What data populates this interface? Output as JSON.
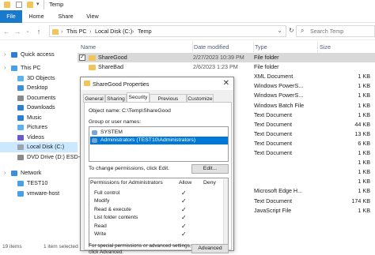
{
  "window": {
    "title": "Temp"
  },
  "ribbon": {
    "tabs": [
      "File",
      "Home",
      "Share",
      "View"
    ]
  },
  "address": {
    "path": [
      "This PC",
      "Local Disk (C:)",
      "Temp"
    ],
    "search_placeholder": "Search Temp"
  },
  "nav": {
    "items": [
      {
        "label": "Quick access",
        "icon": "star-icon",
        "color": "#2f7fd1",
        "indent": 0
      },
      {
        "label": "This PC",
        "icon": "computer-icon",
        "color": "#4aa0e6",
        "indent": 0
      },
      {
        "label": "3D Objects",
        "icon": "cube-icon",
        "color": "#5bb3e8",
        "indent": 1
      },
      {
        "label": "Desktop",
        "icon": "desktop-icon",
        "color": "#3d8fd8",
        "indent": 1
      },
      {
        "label": "Documents",
        "icon": "document-icon",
        "color": "#8a8a8a",
        "indent": 1
      },
      {
        "label": "Downloads",
        "icon": "download-icon",
        "color": "#2f7fd1",
        "indent": 1
      },
      {
        "label": "Music",
        "icon": "music-icon",
        "color": "#2f7fd1",
        "indent": 1
      },
      {
        "label": "Pictures",
        "icon": "picture-icon",
        "color": "#5bb3e8",
        "indent": 1
      },
      {
        "label": "Videos",
        "icon": "video-icon",
        "color": "#6a5acd",
        "indent": 1
      },
      {
        "label": "Local Disk (C:)",
        "icon": "drive-icon",
        "color": "#9aa5b1",
        "indent": 1,
        "selected": true
      },
      {
        "label": "DVD Drive (D:) ESD-",
        "icon": "dvd-icon",
        "color": "#8a8a8a",
        "indent": 1
      },
      {
        "label": "Network",
        "icon": "network-icon",
        "color": "#3d8fd8",
        "indent": 0
      },
      {
        "label": "TEST10",
        "icon": "pc-icon",
        "color": "#4aa0e6",
        "indent": 1
      },
      {
        "label": "vmware-host",
        "icon": "pc-icon",
        "color": "#4aa0e6",
        "indent": 1
      }
    ]
  },
  "list": {
    "headers": {
      "name": "Name",
      "date": "Date modified",
      "type": "Type",
      "size": "Size"
    },
    "rows": [
      {
        "name": "ShareGood",
        "date": "2/27/2023 10:39 PM",
        "type": "File folder",
        "size": "",
        "selected": true,
        "folder": true
      },
      {
        "name": "ShareBad",
        "date": "2/6/2023 1:23 PM",
        "type": "File folder",
        "size": "",
        "folder": true
      },
      {
        "name": "",
        "date": "",
        "type": "XML Document",
        "size": "1 KB"
      },
      {
        "name": "",
        "date": "",
        "type": "Windows PowerS...",
        "size": "1 KB"
      },
      {
        "name": "",
        "date": "",
        "type": "Windows PowerS...",
        "size": "1 KB"
      },
      {
        "name": "",
        "date": "",
        "type": "Windows Batch File",
        "size": "1 KB"
      },
      {
        "name": "",
        "date": "",
        "type": "Text Document",
        "size": "1 KB"
      },
      {
        "name": "",
        "date": "",
        "type": "Text Document",
        "size": "44 KB"
      },
      {
        "name": "",
        "date": "",
        "type": "Text Document",
        "size": "13 KB"
      },
      {
        "name": "",
        "date": "",
        "type": "Text Document",
        "size": "6 KB"
      },
      {
        "name": "",
        "date": "",
        "type": "Text Document",
        "size": "1 KB"
      },
      {
        "name": "",
        "date": "",
        "type": "",
        "size": "1 KB"
      },
      {
        "name": "",
        "date": "",
        "type": "",
        "size": "1 KB"
      },
      {
        "name": "",
        "date": "",
        "type": "",
        "size": "1 KB"
      },
      {
        "name": "",
        "date": "",
        "type": "Microsoft Edge H...",
        "size": "1 KB"
      },
      {
        "name": "",
        "date": "",
        "type": "Text Document",
        "size": "174 KB"
      },
      {
        "name": "",
        "date": "",
        "type": "JavaScript File",
        "size": "1 KB"
      }
    ]
  },
  "status": {
    "count": "19 items",
    "selected": "1 item selected"
  },
  "dialog": {
    "title": "ShareGood Properties",
    "tabs": [
      "General",
      "Sharing",
      "Security",
      "Previous Versions",
      "Customize"
    ],
    "object_label": "Object name:",
    "object_value": "C:\\Temp\\ShareGood",
    "group_label": "Group or user names:",
    "groups": [
      {
        "label": "SYSTEM"
      },
      {
        "label": "Administrators (TEST10\\Administrators)",
        "selected": true
      }
    ],
    "change_text": "To change permissions, click Edit.",
    "edit_button": "Edit...",
    "perm_header": "Permissions for Administrators",
    "allow": "Allow",
    "deny": "Deny",
    "permissions": [
      {
        "name": "Full control",
        "allow": "✓",
        "deny": ""
      },
      {
        "name": "Modify",
        "allow": "✓",
        "deny": ""
      },
      {
        "name": "Read & execute",
        "allow": "✓",
        "deny": ""
      },
      {
        "name": "List folder contents",
        "allow": "✓",
        "deny": ""
      },
      {
        "name": "Read",
        "allow": "✓",
        "deny": ""
      },
      {
        "name": "Write",
        "allow": "✓",
        "deny": ""
      }
    ],
    "advanced_text1": "For special permissions or advanced settings,",
    "advanced_text2": "click Advanced.",
    "advanced_button": "Advanced"
  }
}
